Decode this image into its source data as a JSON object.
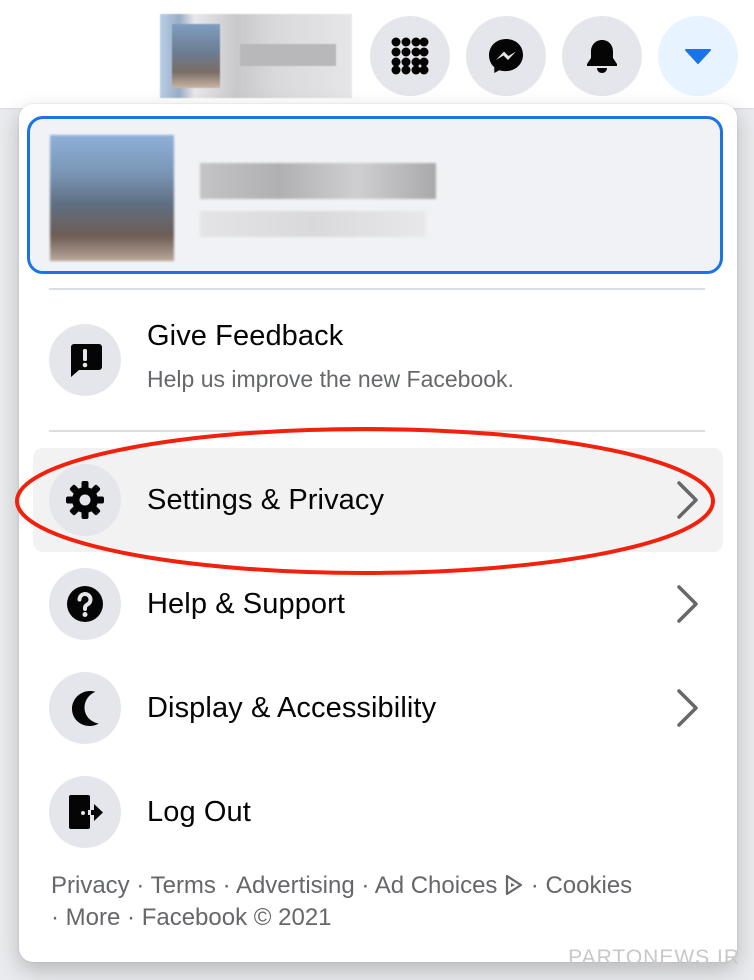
{
  "topbar": {
    "icons": [
      "menu-grid-icon",
      "messenger-icon",
      "bell-icon",
      "caret-down-icon"
    ]
  },
  "menu": {
    "feedback": {
      "title": "Give Feedback",
      "subtitle": "Help us improve the new Facebook."
    },
    "items": [
      {
        "label": "Settings & Privacy",
        "icon": "gear-icon"
      },
      {
        "label": "Help & Support",
        "icon": "question-icon"
      },
      {
        "label": "Display & Accessibility",
        "icon": "moon-icon"
      },
      {
        "label": "Log Out",
        "icon": "logout-icon"
      }
    ],
    "footer": {
      "privacy": "Privacy",
      "terms": "Terms",
      "advertising": "Advertising",
      "ad_choices": "Ad Choices",
      "cookies": "Cookies",
      "more": "More",
      "copyright": "Facebook © 2021",
      "sep": "·"
    }
  },
  "colors": {
    "accent": "#1b74e4",
    "highlight_ellipse": "#f1210e"
  },
  "watermark": "PARTONEWS.IR"
}
